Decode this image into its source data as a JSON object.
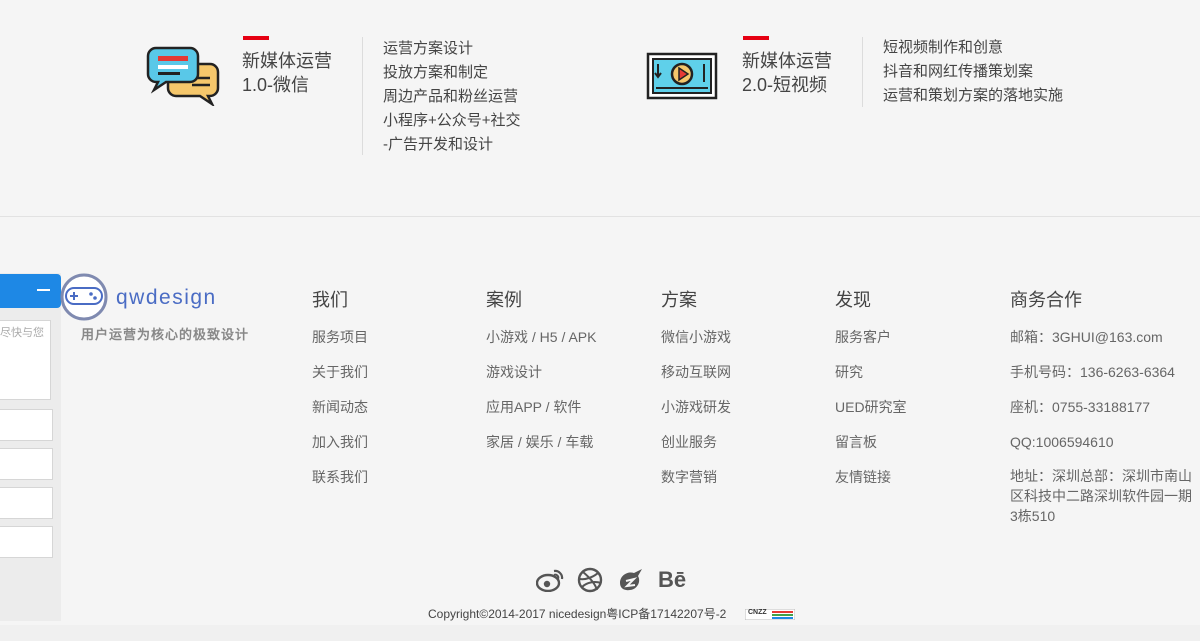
{
  "services": [
    {
      "title_line1": "新媒体运营",
      "title_line2": "1.0-微信",
      "icon": "chat-bubbles-icon",
      "items": [
        "运营方案设计",
        "投放方案和制定",
        "周边产品和粉丝运营",
        "小程序+公众号+社交",
        "-广告开发和设计"
      ]
    },
    {
      "title_line1": "新媒体运营",
      "title_line2": "2.0-短视频",
      "icon": "video-player-icon",
      "items": [
        "短视频制作和创意",
        "抖音和网红传播策划案",
        "运营和策划方案的落地实施"
      ]
    }
  ],
  "side_panel": {
    "hint_text": "尽快与您"
  },
  "logo": {
    "wordmark": "qwdesign",
    "tagline": "用户运营为核心的极致设计"
  },
  "footer": {
    "columns": [
      {
        "title": "我们",
        "links": [
          "服务项目",
          "关于我们",
          "新闻动态",
          "加入我们",
          "联系我们"
        ]
      },
      {
        "title": "案例",
        "links": [
          "小游戏 / H5 / APK",
          "游戏设计",
          "应用APP / 软件",
          "家居 / 娱乐 / 车载"
        ]
      },
      {
        "title": "方案",
        "links": [
          "微信小游戏",
          "移动互联网",
          "小游戏研发",
          "创业服务",
          "数字营销"
        ]
      },
      {
        "title": "发现",
        "links": [
          "服务客户",
          "研究",
          "UED研究室",
          "留言板",
          "友情链接"
        ]
      }
    ],
    "contact": {
      "title": "商务合作",
      "email": "邮箱：3GHUI@163.com",
      "phone": "手机号码：136-6263-6364",
      "landline": "座机：0755-33188177",
      "qq": "QQ:1006594610",
      "address": "地址：深圳总部：深圳市南山区科技中二路深圳软件园一期3栋510"
    }
  },
  "social": [
    {
      "name": "weibo-icon"
    },
    {
      "name": "dribbble-icon"
    },
    {
      "name": "zcool-icon"
    },
    {
      "name": "behance-icon",
      "label": "Bē"
    }
  ],
  "copyright": "Copyright©2014-2017 nicedesign粤ICP备17142207号-2",
  "badge_text": "CNZZ",
  "colors": {
    "accent_red": "#e60012",
    "brand_blue": "#1e88e5",
    "logo_blue": "#4a6cc4"
  }
}
